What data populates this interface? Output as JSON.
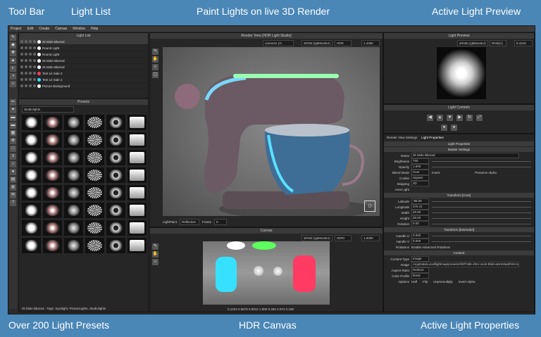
{
  "callouts": {
    "tool_bar": "Tool Bar",
    "light_list": "Light List",
    "paint_lights": "Paint Lights on live 3D Render",
    "active_preview": "Active Light Preview",
    "presets": "Over 200 Light Presets",
    "hdr_canvas": "HDR Canvas",
    "active_props": "Active Light Properties"
  },
  "menu": [
    "Project",
    "Edit",
    "Create",
    "Canvas",
    "Window",
    "Help"
  ],
  "light_list": {
    "title": "Light List",
    "items": [
      {
        "label": "2k Mole Blurred",
        "color": "#ffffff"
      },
      {
        "label": "Round Light",
        "color": "#ffffff"
      },
      {
        "label": "Round Light",
        "color": "#ffffff"
      },
      {
        "label": "2k Mole Blurred",
        "color": "#ffffff"
      },
      {
        "label": "2k Mole Blurred",
        "color": "#ffffff"
      },
      {
        "label": "Tent Lit Side 2",
        "color": "#ff3b5c"
      },
      {
        "label": "Tent Lit Side 2",
        "color": "#2ee0ff"
      },
      {
        "label": "Picture Background",
        "color": "#ffffff"
      }
    ]
  },
  "presets": {
    "title": "Presets",
    "category": "Studiolights",
    "footer": "2k Mole Blurred - Tags: Spotlight, PictureLights, Studiolights"
  },
  "render_view": {
    "title": "Render View [HDR Light Studio]",
    "camera": "camera1 (rs",
    "colorspace": "sRGB (rgbMonitor)",
    "mode": "HDR",
    "zoom": "1.4360",
    "lightpaint": "LightPaint",
    "reflection": "Reflection",
    "frame_label": "Frame",
    "frame_value": "0"
  },
  "canvas": {
    "title": "Canvas",
    "colorspace": "sRGB (rgbMonitor)",
    "mode": "HDRI",
    "zoom": "1.0000",
    "status": "0.1234 0.5678 0.9012 1.000  0.484 0.074 0.168"
  },
  "preview": {
    "title": "Light Preview",
    "colorspace": "sRGB (rgbMonitor)",
    "mode": "RGB(A)",
    "zoom": "0.4318"
  },
  "controls": {
    "title": "Light Controls"
  },
  "properties": {
    "tabs": [
      "Render View Settings",
      "Light Properties"
    ],
    "header": "Light Properties",
    "master": "Master Settings",
    "name_label": "Name",
    "name_value": "2k Mole Blurred",
    "brightness_label": "Brightness",
    "brightness_value": "700",
    "opacity_label": "Opacity",
    "opacity_value": "1.000",
    "blend_label": "Blend Mode",
    "blend_value": "Over",
    "invert_label": "Invert",
    "preserve_label": "Preserve Alpha",
    "cookie_label": "Cookie",
    "cookie_value": "Square",
    "mapping_label": "Mapping",
    "mapping_value": "3D",
    "arealight_label": "Area Light",
    "transform_core": "Transform [Core]",
    "latitude_label": "Latitude",
    "latitude_value": "-88.68",
    "longitude_label": "Longitude",
    "longitude_value": "275.41",
    "width_label": "Width",
    "width_value": "20.00",
    "height_label": "Height",
    "height_value": "20.00",
    "rotation_label": "Rotation",
    "rotation_value": "0.00",
    "transform_ext": "Transform [Extended]",
    "handleu_label": "Handle U",
    "handleu_value": "0.000",
    "handlev_label": "Handle V",
    "handlev_value": "0.000",
    "rotations_label": "Rotations",
    "enable_adv": "Enable Advanced Rotations",
    "content": "Content",
    "content_type_label": "Content Type",
    "content_type_value": "Image",
    "image_label": "Image",
    "image_value": "/AppData/Local/lightmap/presets/2f4f726b-4f44-4cd4-bfa9-a61919a0f434.tx",
    "aspect_label": "Aspect Ratio",
    "restore_label": "Restore",
    "color_profile_label": "Color Profile",
    "color_profile_value": "linear",
    "options_label": "Options",
    "half_label": "Half",
    "flip_label": "Flip",
    "unpremultiply_label": "Unpremultiply",
    "invert_alpha_label": "Invert Alpha"
  }
}
